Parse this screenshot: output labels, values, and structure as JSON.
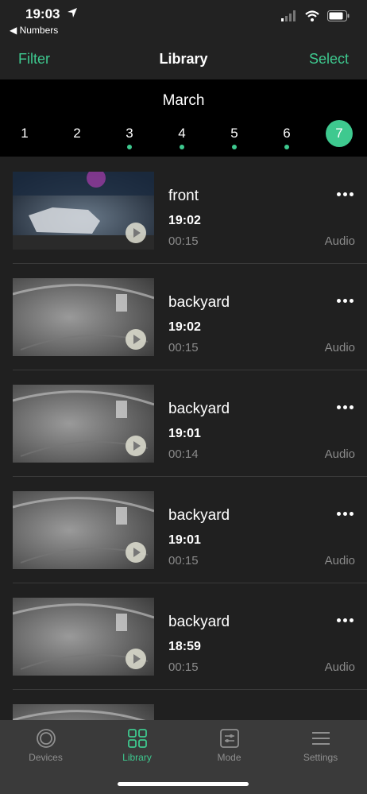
{
  "status_bar": {
    "time": "19:03",
    "back_app": "◀ Numbers",
    "icons": [
      "location-arrow-icon",
      "cellular-signal-icon",
      "wifi-icon",
      "battery-icon"
    ]
  },
  "nav": {
    "left_label": "Filter",
    "title": "Library",
    "right_label": "Select",
    "accent": "#3ec98f"
  },
  "calendar": {
    "month": "March",
    "days": [
      {
        "label": "1",
        "has_recordings": false,
        "selected": false
      },
      {
        "label": "2",
        "has_recordings": false,
        "selected": false
      },
      {
        "label": "3",
        "has_recordings": true,
        "selected": false
      },
      {
        "label": "4",
        "has_recordings": true,
        "selected": false
      },
      {
        "label": "5",
        "has_recordings": true,
        "selected": false
      },
      {
        "label": "6",
        "has_recordings": true,
        "selected": false
      },
      {
        "label": "7",
        "has_recordings": false,
        "selected": true
      }
    ]
  },
  "recordings": [
    {
      "camera": "front",
      "time": "19:02",
      "duration": "00:15",
      "tag": "Audio",
      "thumb": "night-color"
    },
    {
      "camera": "backyard",
      "time": "19:02",
      "duration": "00:15",
      "tag": "Audio",
      "thumb": "ir-gray"
    },
    {
      "camera": "backyard",
      "time": "19:01",
      "duration": "00:14",
      "tag": "Audio",
      "thumb": "ir-gray"
    },
    {
      "camera": "backyard",
      "time": "19:01",
      "duration": "00:15",
      "tag": "Audio",
      "thumb": "ir-gray"
    },
    {
      "camera": "backyard",
      "time": "18:59",
      "duration": "00:15",
      "tag": "Audio",
      "thumb": "ir-gray"
    }
  ],
  "tabs": [
    {
      "label": "Devices",
      "icon": "devices-icon",
      "active": false
    },
    {
      "label": "Library",
      "icon": "library-grid-icon",
      "active": true
    },
    {
      "label": "Mode",
      "icon": "mode-sliders-icon",
      "active": false
    },
    {
      "label": "Settings",
      "icon": "settings-menu-icon",
      "active": false
    }
  ]
}
